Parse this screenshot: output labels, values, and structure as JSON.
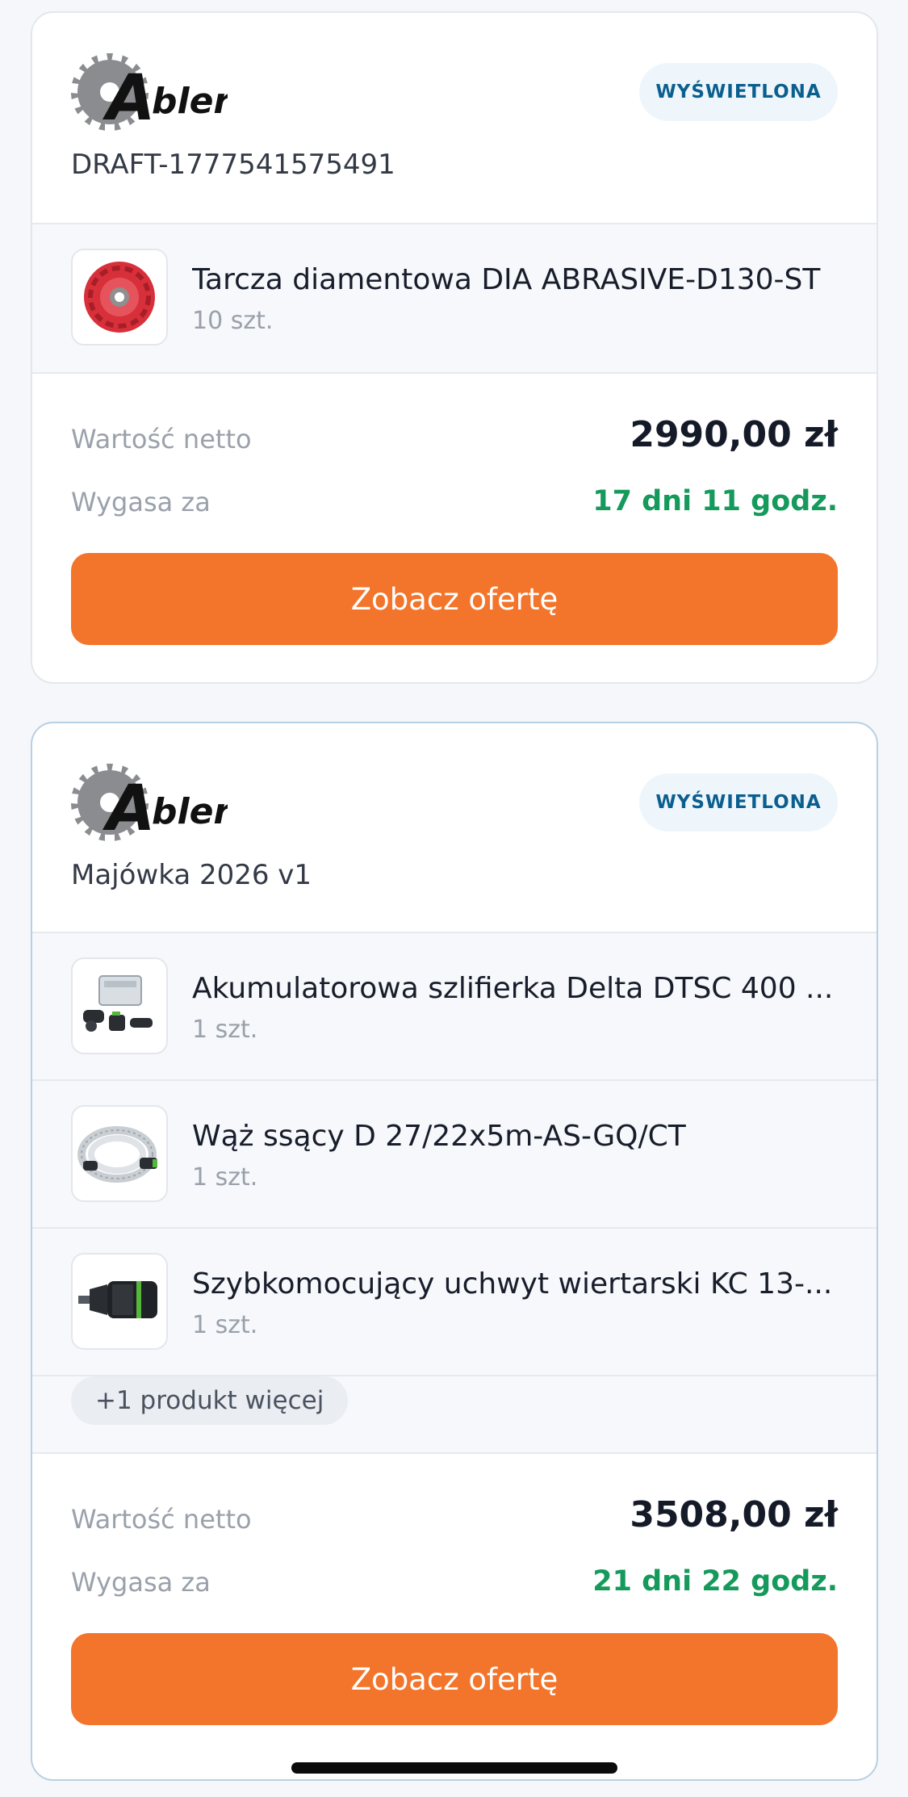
{
  "offers": [
    {
      "status": "WYŚWIETLONA",
      "name": "DRAFT-1777541575491",
      "items": [
        {
          "title": "Tarcza diamentowa DIA ABRASIVE-D130-ST",
          "qty": "10 szt.",
          "icon": "diamond-disc-icon"
        }
      ],
      "net_label": "Wartość netto",
      "net_value": "2990,00 zł",
      "expires_label": "Wygasa za",
      "expires_value": "17 dni 11 godz.",
      "cta": "Zobacz ofertę"
    },
    {
      "status": "WYŚWIETLONA",
      "name": "Majówka 2026 v1",
      "items": [
        {
          "title": "Akumulatorowa szlifierka Delta DTSC 400 ...",
          "qty": "1 szt.",
          "icon": "sander-kit-icon"
        },
        {
          "title": "Wąż ssący D 27/22x5m-AS-GQ/CT",
          "qty": "1 szt.",
          "icon": "hose-icon"
        },
        {
          "title": "Szybkomocujący uchwyt wiertarski KC 13-...",
          "qty": "1 szt.",
          "icon": "drill-chuck-icon"
        }
      ],
      "more_label": "+1 produkt więcej",
      "net_label": "Wartość netto",
      "net_value": "3508,00 zł",
      "expires_label": "Wygasa za",
      "expires_value": "21 dni 22 godz.",
      "cta": "Zobacz ofertę"
    }
  ],
  "brand": {
    "logo_text": "Abler",
    "accent": "#f3752b",
    "status_color": "#0b5f8f",
    "expiry_color": "#159a5c"
  }
}
